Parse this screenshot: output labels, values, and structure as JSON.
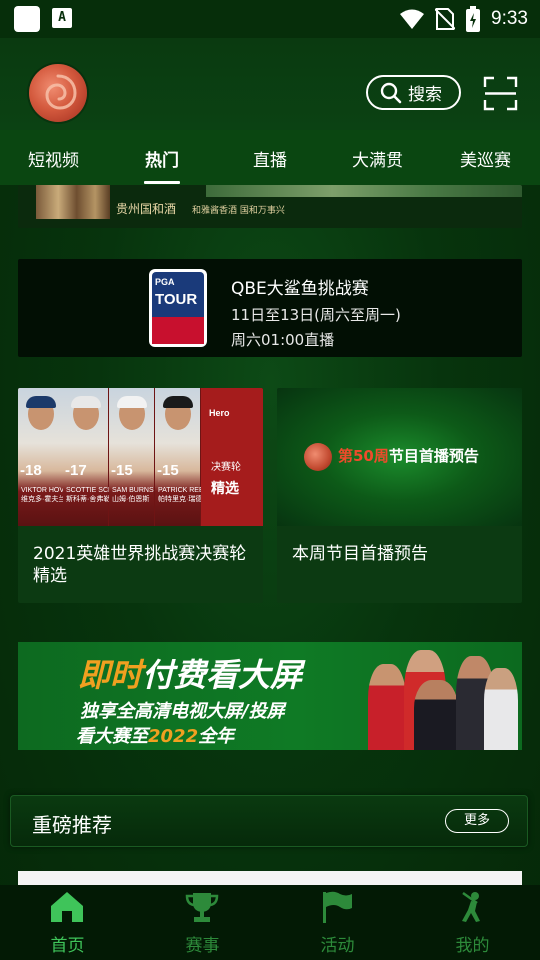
{
  "status_bar": {
    "time": "9:33",
    "notif_a": "A"
  },
  "header": {
    "search_label": "搜索"
  },
  "tabs": [
    {
      "label": "短视频"
    },
    {
      "label": "热门"
    },
    {
      "label": "直播"
    },
    {
      "label": "大满贯"
    },
    {
      "label": "美巡赛"
    }
  ],
  "active_tab": "热门",
  "top_ad": {
    "brand": "贵州国和酒",
    "slogan": "和雅酱香酒 国和万事兴"
  },
  "match": {
    "logo_text_top": "PGA",
    "logo_text_main": "TOUR",
    "title": "QBE大鲨鱼挑战赛",
    "dates": "11日至13日(周六至周一)",
    "broadcast": "周六01:00直播"
  },
  "videos": [
    {
      "title": "2021英雄世界挑战赛决赛轮精选",
      "players": [
        {
          "score": "-18",
          "name": "VIKTOR HOVLAND\n维克多·霍夫兰"
        },
        {
          "score": "-17",
          "name": "SCOTTIE SCHEFFLER\n斯科蒂·舍弗勒"
        },
        {
          "score": "-15",
          "name": "SAM BURNS\n山姆·伯恩斯"
        },
        {
          "score": "-15",
          "name": "PATRICK REED\n帕特里克·瑞德"
        }
      ],
      "panel_brand": "Hero",
      "panel_round": "决赛轮",
      "panel_label": "精选"
    },
    {
      "title": "本周节目首播预告",
      "promo_highlight": "第50周",
      "promo_rest": "节目首播预告"
    }
  ],
  "banner": {
    "line1_highlight": "即时",
    "line1_rest": "付费看大屏",
    "line2": "独享全高清电视大屏/投屏",
    "line3_start": "看大赛至",
    "line3_highlight": "2022",
    "line3_end": "全年"
  },
  "recommend": {
    "title": "重磅推荐",
    "more_label": "更多"
  },
  "bottom_nav": [
    {
      "label": "首页",
      "icon": "home-icon",
      "active": true
    },
    {
      "label": "赛事",
      "icon": "trophy-icon",
      "active": false
    },
    {
      "label": "活动",
      "icon": "flag-icon",
      "active": false
    },
    {
      "label": "我的",
      "icon": "golfer-icon",
      "active": false
    }
  ],
  "colors": {
    "background": "#07340d",
    "nav_active": "#3fc45a",
    "nav_inactive": "#2d8a3a",
    "accent_orange": "#f0a020",
    "accent_red": "#ef4b2b"
  }
}
